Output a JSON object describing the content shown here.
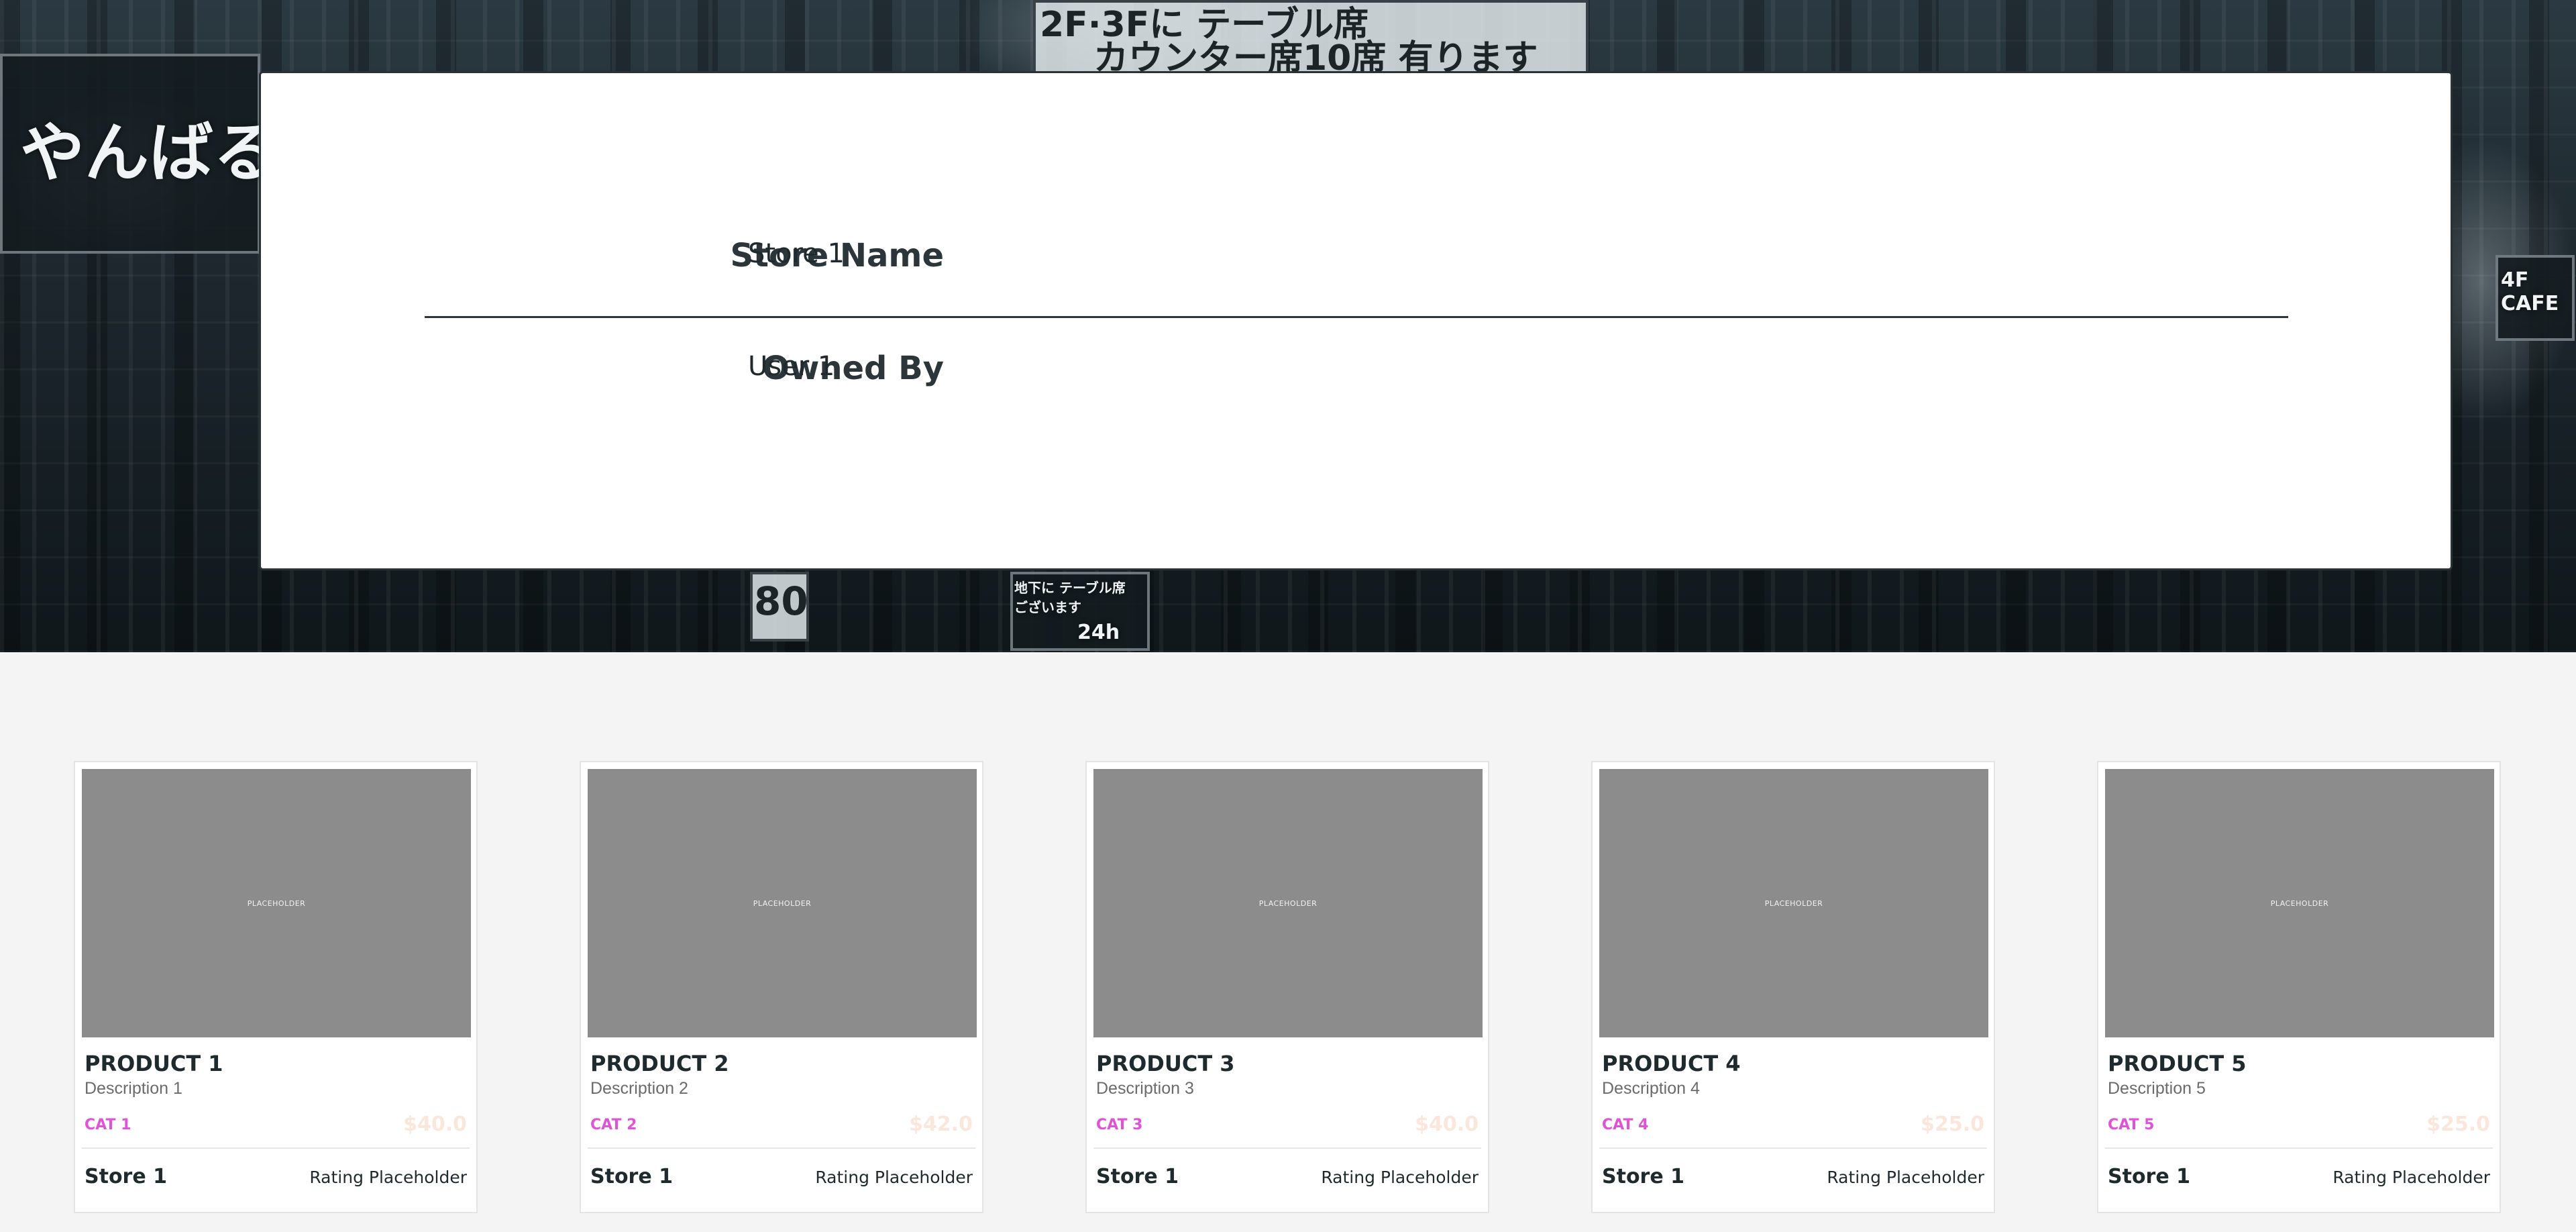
{
  "hero": {
    "signs": [
      {
        "text": "やんばる",
        "style": "light"
      },
      {
        "text": "2F·3Fに テーブル席",
        "style": "dark"
      },
      {
        "text": "カウンター席10席 有ります",
        "style": "dark"
      },
      {
        "text": "4F CAFE",
        "style": "light"
      },
      {
        "text": "80",
        "style": "light"
      },
      {
        "text": "地下に テーブル席 ございます",
        "style": "light"
      },
      {
        "text": "24h",
        "style": "light"
      }
    ]
  },
  "store": {
    "name_label": "Store Name",
    "name_value": "Store 1",
    "owner_label": "Owned By",
    "owner_value": "User 1"
  },
  "products": [
    {
      "title": "PRODUCT 1",
      "description": "Description 1",
      "category": "CAT 1",
      "price": "$40.0",
      "store": "Store 1",
      "rating": "Rating Placeholder",
      "image_text": "PLACEHOLDER"
    },
    {
      "title": "PRODUCT 2",
      "description": "Description 2",
      "category": "CAT 2",
      "price": "$42.0",
      "store": "Store 1",
      "rating": "Rating Placeholder",
      "image_text": "PLACEHOLDER"
    },
    {
      "title": "PRODUCT 3",
      "description": "Description 3",
      "category": "CAT 3",
      "price": "$40.0",
      "store": "Store 1",
      "rating": "Rating Placeholder",
      "image_text": "PLACEHOLDER"
    },
    {
      "title": "PRODUCT 4",
      "description": "Description 4",
      "category": "CAT 4",
      "price": "$25.0",
      "store": "Store 1",
      "rating": "Rating Placeholder",
      "image_text": "PLACEHOLDER"
    },
    {
      "title": "PRODUCT 5",
      "description": "Description 5",
      "category": "CAT 5",
      "price": "$25.0",
      "store": "Store 1",
      "rating": "Rating Placeholder",
      "image_text": "PLACEHOLDER"
    }
  ],
  "colors": {
    "category": "#e052d6",
    "price": "#fbe6dc",
    "panel_border": "#2a3236",
    "image_placeholder": "#8c8c8c",
    "page_background": "#f4f4f4"
  }
}
